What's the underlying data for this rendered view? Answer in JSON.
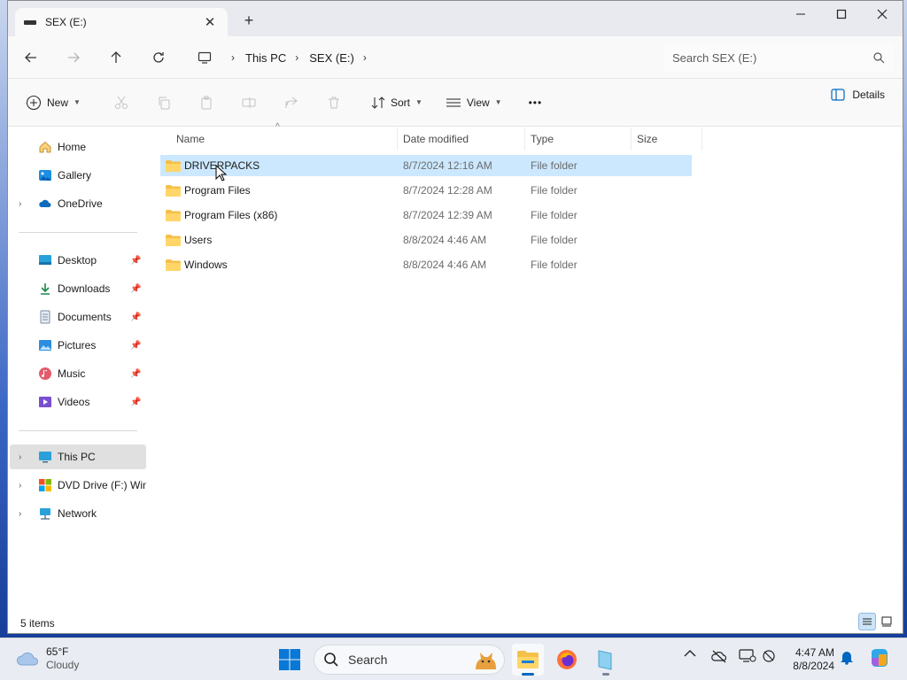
{
  "window": {
    "tab_title": "SEX (E:)",
    "new_tab_label": "+"
  },
  "address": {
    "breadcrumb": [
      "This PC",
      "SEX (E:)"
    ],
    "search_placeholder": "Search SEX (E:)"
  },
  "commandbar": {
    "new_label": "New",
    "sort_label": "Sort",
    "view_label": "View",
    "more_label": "•••",
    "details_label": "Details"
  },
  "navpane": {
    "items": [
      {
        "label": "Home",
        "icon": "home-icon"
      },
      {
        "label": "Gallery",
        "icon": "gallery-icon"
      },
      {
        "label": "OneDrive",
        "icon": "onedrive-icon"
      },
      {
        "label": "Desktop",
        "icon": "desktop-icon",
        "pinned": true
      },
      {
        "label": "Downloads",
        "icon": "downloads-icon",
        "pinned": true
      },
      {
        "label": "Documents",
        "icon": "documents-icon",
        "pinned": true
      },
      {
        "label": "Pictures",
        "icon": "pictures-icon",
        "pinned": true
      },
      {
        "label": "Music",
        "icon": "music-icon",
        "pinned": true
      },
      {
        "label": "Videos",
        "icon": "videos-icon",
        "pinned": true
      },
      {
        "label": "This PC",
        "icon": "this-pc-icon",
        "selected": true
      },
      {
        "label": "DVD Drive (F:) Winc",
        "icon": "dvd-drive-icon"
      },
      {
        "label": "Network",
        "icon": "network-icon"
      }
    ]
  },
  "filelist": {
    "columns": [
      "Name",
      "Date modified",
      "Type",
      "Size"
    ],
    "rows": [
      {
        "name": "DRIVERPACKS",
        "date": "8/7/2024 12:16 AM",
        "type": "File folder",
        "size": "",
        "selected": true
      },
      {
        "name": "Program Files",
        "date": "8/7/2024 12:28 AM",
        "type": "File folder",
        "size": ""
      },
      {
        "name": "Program Files (x86)",
        "date": "8/7/2024 12:39 AM",
        "type": "File folder",
        "size": ""
      },
      {
        "name": "Users",
        "date": "8/8/2024 4:46 AM",
        "type": "File folder",
        "size": ""
      },
      {
        "name": "Windows",
        "date": "8/8/2024 4:46 AM",
        "type": "File folder",
        "size": ""
      }
    ]
  },
  "status": {
    "item_count": "5 items"
  },
  "taskbar": {
    "weather_temp": "65°F",
    "weather_condition": "Cloudy",
    "search_label": "Search",
    "time": "4:47 AM",
    "date": "8/8/2024"
  },
  "colors": {
    "selection": "#cce8ff",
    "folder": "#f5c04a",
    "accent": "#0067c0"
  }
}
